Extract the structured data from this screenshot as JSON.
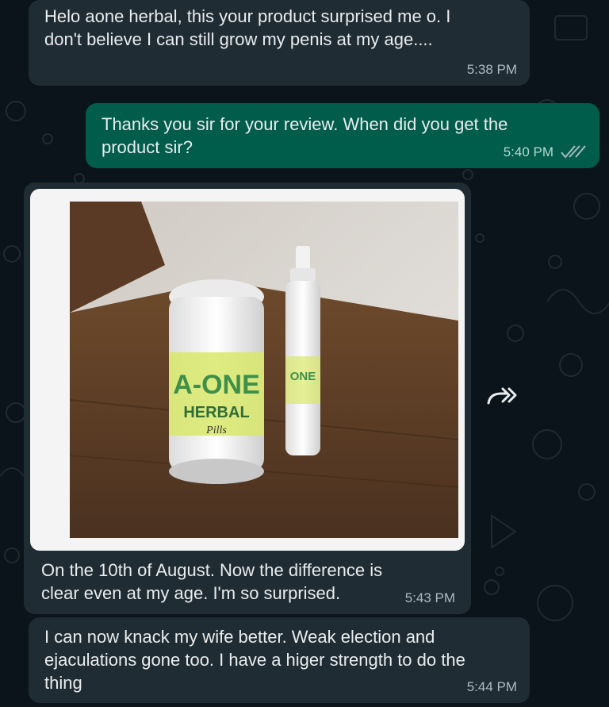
{
  "messages": [
    {
      "direction": "incoming",
      "text": "Helo aone herbal,  this your product surprised me o. I don't believe I can still grow my penis at my age....",
      "time": "5:38 PM"
    },
    {
      "direction": "outgoing",
      "text": "Thanks you sir for your review.  When did you get the product sir?",
      "time": "5:40 PM",
      "status": "read"
    },
    {
      "direction": "incoming",
      "type": "image",
      "caption": "On the 10th of August.  Now the difference is clear even at my age. I'm so surprised.",
      "time": "5:43 PM",
      "image": {
        "jar_label_line1": "A-ONE",
        "jar_label_line2": "HERBAL",
        "jar_label_line3": "Pills",
        "bottle_label": "ONE"
      }
    },
    {
      "direction": "incoming",
      "text": "I can now knack my wife better.  Weak election and ejaculations gone too. I have a higer strength to do the thing",
      "time": "5:44 PM"
    }
  ],
  "colors": {
    "background": "#0b141a",
    "incoming_bubble": "#202c33",
    "outgoing_bubble": "#005c4b",
    "text": "#e9edef",
    "time": "#aebac1",
    "read_ticks": "#aebac1"
  },
  "icons": {
    "forward": "forward-icon",
    "read_receipt": "double-check-icon"
  }
}
